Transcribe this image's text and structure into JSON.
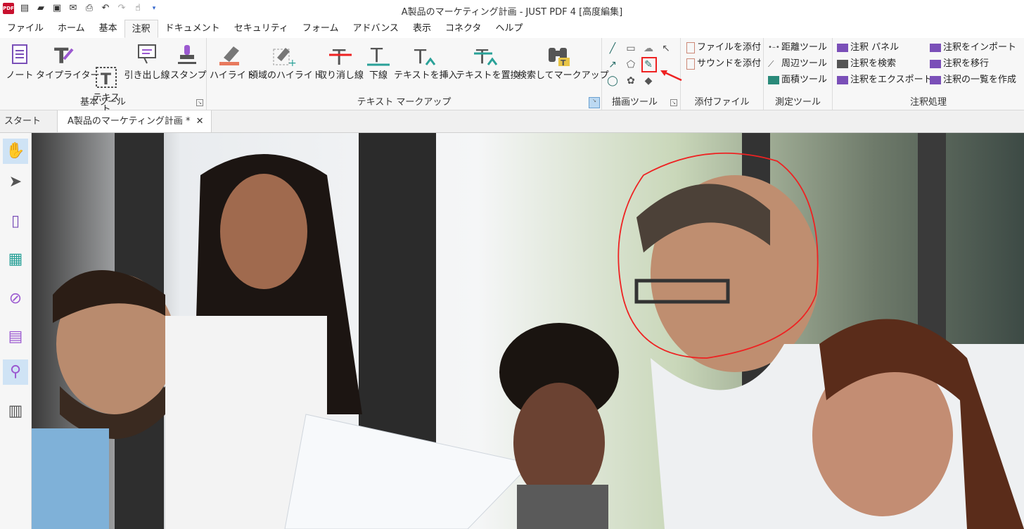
{
  "app": {
    "title": "A製品のマーケティング計画 - JUST PDF 4 [高度編集]",
    "logo_text": "PDF"
  },
  "menu_tabs": [
    "ファイル",
    "ホーム",
    "基本",
    "注釈",
    "ドキュメント",
    "セキュリティ",
    "フォーム",
    "アドバンス",
    "表示",
    "コネクタ",
    "ヘルプ"
  ],
  "active_menu_tab": "注釈",
  "ribbon": {
    "basic_tools": {
      "label": "基本ツール",
      "buttons": [
        "ノート",
        "タイプライター",
        "テキスト\nボックス",
        "引き出し線",
        "スタンプ"
      ]
    },
    "text_markup": {
      "label": "テキスト マークアップ",
      "buttons": [
        "ハイライト",
        "領域のハイライト",
        "取り消し線",
        "下線",
        "テキストを挿入",
        "テキストを置換",
        "検索してマークアップ"
      ]
    },
    "drawing_tools": {
      "label": "描画ツール"
    },
    "attachments": {
      "label": "添付ファイル",
      "items": [
        "ファイルを添付",
        "サウンドを添付"
      ]
    },
    "measure": {
      "label": "測定ツール",
      "items": [
        "距離ツール",
        "周辺ツール",
        "面積ツール"
      ]
    },
    "annotation_processing": {
      "label": "注釈処理",
      "col1": [
        "注釈 パネル",
        "注釈を検索",
        "注釈をエクスポート"
      ],
      "col2": [
        "注釈をインポート",
        "注釈を移行",
        "注釈の一覧を作成"
      ]
    }
  },
  "doc_tabs": {
    "start": "スタート",
    "active": "A製品のマーケティング計画 *"
  },
  "colors": {
    "accent_teal": "#2aa198",
    "annotation_red": "#e22222",
    "highlight_blue": "#cfe3f5"
  }
}
